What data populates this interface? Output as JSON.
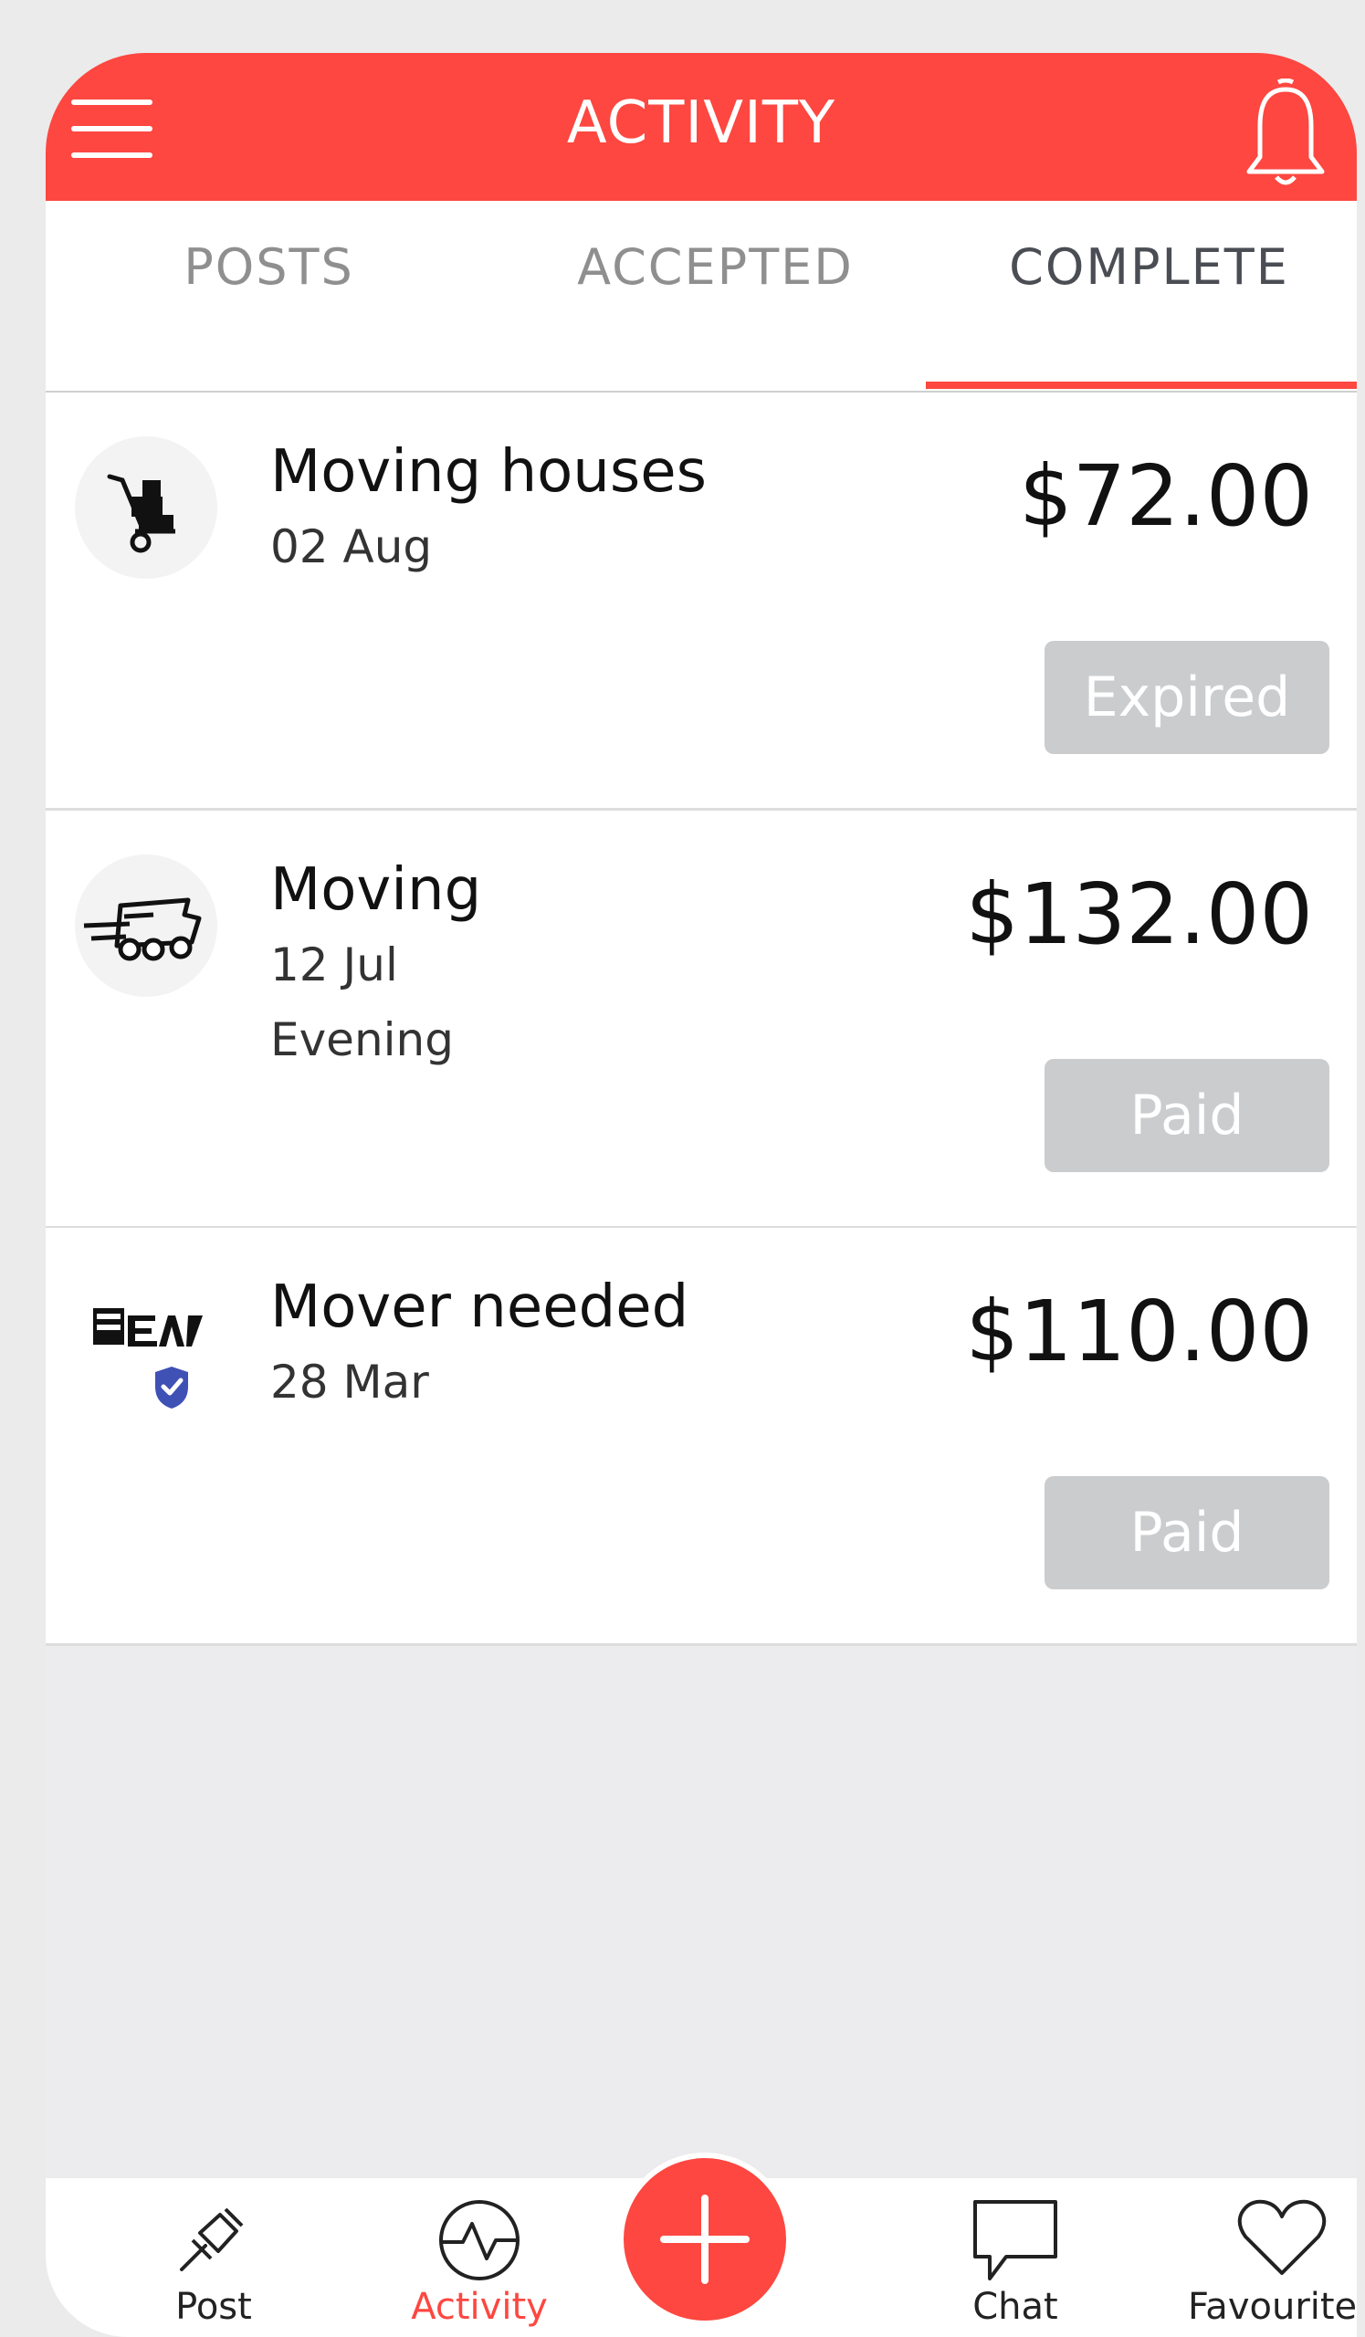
{
  "header": {
    "title": "ACTIVITY"
  },
  "tabs": [
    {
      "label": "POSTS"
    },
    {
      "label": "ACCEPTED"
    },
    {
      "label": "COMPLETE"
    }
  ],
  "active_tab": "COMPLETE",
  "jobs": [
    {
      "title": "Moving houses",
      "date": "02 Aug",
      "time": "",
      "price": "$72.00",
      "status": "Expired",
      "icon": "hand-truck-icon"
    },
    {
      "title": "Moving",
      "date": "12 Jul",
      "time": "Evening",
      "price": "$132.00",
      "status": "Paid",
      "icon": "moving-truck-icon"
    },
    {
      "title": "Mover needed",
      "date": "28 Mar",
      "time": "",
      "price": "$110.00",
      "status": "Paid",
      "icon": "mover-logo-icon"
    }
  ],
  "nav": [
    {
      "label": "Post",
      "icon": "pin-icon"
    },
    {
      "label": "Activity",
      "icon": "activity-icon"
    },
    {
      "label": "Chat",
      "icon": "chat-bubble-icon"
    },
    {
      "label": "Favourites",
      "icon": "heart-icon"
    }
  ],
  "colors": {
    "accent": "#fd4740",
    "badge": "#cbccce",
    "background": "#ececee"
  }
}
